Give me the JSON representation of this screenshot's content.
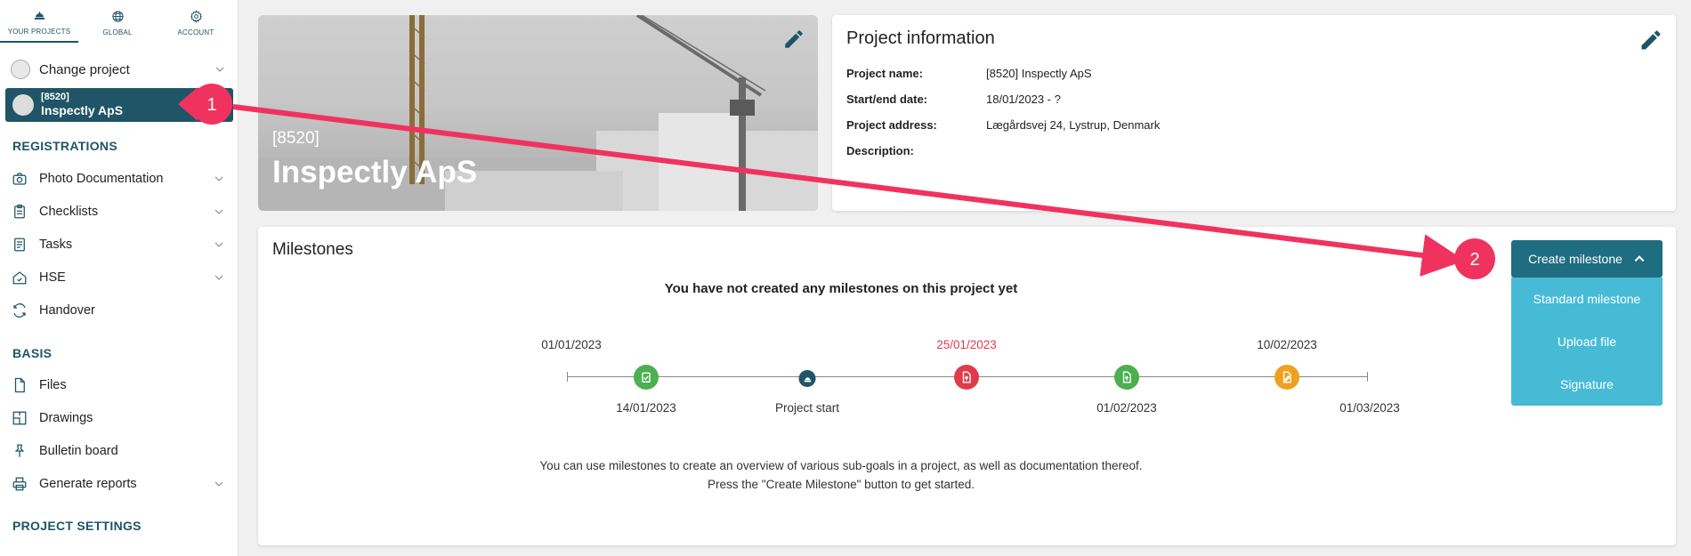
{
  "topnav": {
    "tabs": [
      {
        "label": "YOUR PROJECTS",
        "icon": "helmet-icon"
      },
      {
        "label": "GLOBAL",
        "icon": "globe-icon"
      },
      {
        "label": "ACCOUNT",
        "icon": "gear-icon"
      }
    ]
  },
  "sidebar": {
    "change_project": "Change project",
    "current_project": {
      "code": "[8520]",
      "name": "Inspectly ApS"
    },
    "registrations_header": "REGISTRATIONS",
    "registrations": [
      {
        "label": "Photo Documentation",
        "icon": "camera-icon"
      },
      {
        "label": "Checklists",
        "icon": "clipboard-icon"
      },
      {
        "label": "Tasks",
        "icon": "task-list-icon"
      },
      {
        "label": "HSE",
        "icon": "safety-house-icon"
      },
      {
        "label": "Handover",
        "icon": "sync-icon"
      }
    ],
    "basis_header": "BASIS",
    "basis": [
      {
        "label": "Files",
        "icon": "file-icon"
      },
      {
        "label": "Drawings",
        "icon": "drawing-icon"
      },
      {
        "label": "Bulletin board",
        "icon": "pin-icon"
      },
      {
        "label": "Generate reports",
        "icon": "printer-icon"
      }
    ],
    "project_settings_header": "PROJECT SETTINGS"
  },
  "hero": {
    "code": "[8520]",
    "name": "Inspectly ApS"
  },
  "project_info": {
    "title": "Project information",
    "rows": [
      {
        "key": "Project name:",
        "value": "[8520] Inspectly ApS"
      },
      {
        "key": "Start/end date:",
        "value": "18/01/2023 - ?"
      },
      {
        "key": "Project address:",
        "value": "Lægårdsvej 24, Lystrup, Denmark"
      }
    ],
    "description_key": "Description:",
    "description_value": "-"
  },
  "milestones": {
    "title": "Milestones",
    "empty_text": "You have not created any milestones on this project yet",
    "help_line1": "You can use milestones to create an overview of various sub-goals in a project, as well as documentation thereof.",
    "help_line2": "Press the \"Create Milestone\" button to get started.",
    "timeline_top_dates": [
      "01/01/2023",
      "25/01/2023",
      "10/02/2023"
    ],
    "timeline_bottom_dates": [
      "14/01/2023",
      "Project start",
      "01/02/2023",
      "01/03/2023"
    ],
    "create_button": "Create milestone",
    "menu": [
      "Standard milestone",
      "Upload file",
      "Signature"
    ]
  },
  "callouts": [
    "1",
    "2"
  ],
  "colors": {
    "primary": "#1f5566",
    "button": "#1f6d80",
    "menu": "#47bbd5",
    "green": "#4caf50",
    "red": "#e03b4a",
    "orange": "#f0a020",
    "arrow": "#f0325f"
  }
}
